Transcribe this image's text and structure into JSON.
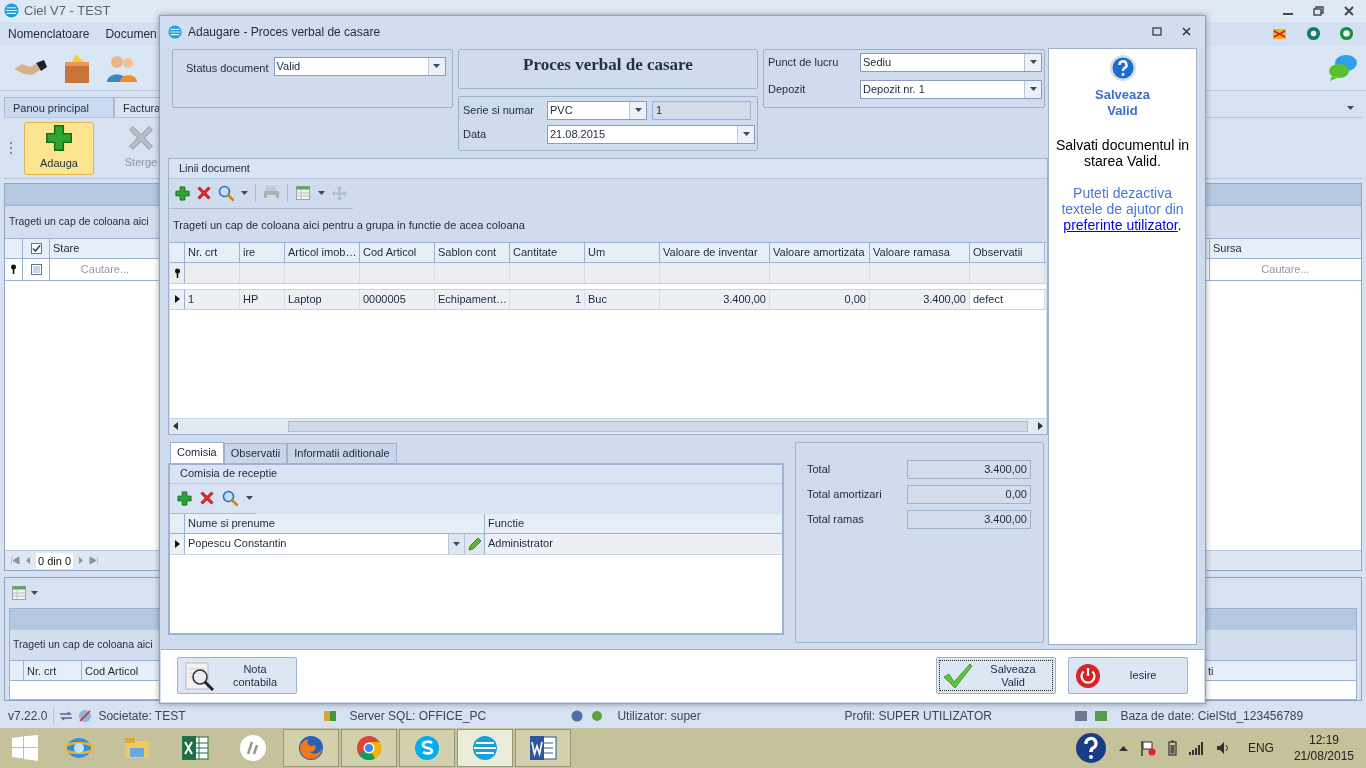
{
  "main_window": {
    "title": "Ciel V7 - TEST",
    "menu": [
      "Nomenclatoare",
      "Documen"
    ],
    "ribbon_tabs": [
      {
        "label": "Panou principal",
        "selected": true
      },
      {
        "label": "Factura",
        "selected": false
      }
    ],
    "ribbon_buttons": [
      {
        "label": "Adauga",
        "kind": "add",
        "highlighted": true,
        "disabled": false
      },
      {
        "label": "Sterge",
        "kind": "delete",
        "highlighted": false,
        "disabled": true
      }
    ],
    "grid": {
      "group_hint": "Trageti un cap de coloana aici",
      "columns": [
        "Stare",
        "Sursa"
      ],
      "header_checked": true,
      "filter_checked": false,
      "filter_placeholders": [
        "Cautare...",
        "Cautare..."
      ],
      "pager": "0 din 0"
    },
    "lower_grid": {
      "group_hint": "Trageti un cap de coloana aici",
      "columns": [
        "Nr. crt",
        "Cod Articol",
        "ti"
      ]
    }
  },
  "dialog": {
    "title": "Adaugare - Proces verbal de casare",
    "status": {
      "label": "Status document",
      "value": "Valid"
    },
    "heading": "Proces verbal de casare",
    "series": {
      "label": "Serie si numar",
      "value": "PVC",
      "number": "1"
    },
    "date": {
      "label": "Data",
      "value": "21.08.2015"
    },
    "work_point": {
      "label": "Punct de lucru",
      "value": "Sediu"
    },
    "warehouse": {
      "label": "Depozit",
      "value": "Depozit nr. 1"
    },
    "lines": {
      "title": "Linii document",
      "group_hint": "Trageti un cap de coloana aici pentru a grupa in functie de acea coloana",
      "columns": [
        {
          "label": "Nr. crt",
          "kind": "text"
        },
        {
          "label": "ire",
          "kind": "text"
        },
        {
          "label": "Articol imob…",
          "kind": "text"
        },
        {
          "label": "Cod Articol",
          "kind": "text"
        },
        {
          "label": "Sablon cont",
          "kind": "text"
        },
        {
          "label": "Cantitate",
          "kind": "number"
        },
        {
          "label": "Um",
          "kind": "text"
        },
        {
          "label": "Valoare de inventar",
          "kind": "number"
        },
        {
          "label": "Valoare amortizata",
          "kind": "number"
        },
        {
          "label": "Valoare ramasa",
          "kind": "number"
        },
        {
          "label": "Observatii",
          "kind": "text"
        }
      ],
      "rows": [
        {
          "selected": true,
          "cells": [
            "1",
            "HP",
            "Laptop",
            "0000005",
            "Echipament…",
            "1",
            "Buc",
            "3.400,00",
            "0,00",
            "3.400,00",
            "defect"
          ]
        }
      ]
    },
    "tabs": [
      {
        "label": "Comisia",
        "selected": true
      },
      {
        "label": "Observatii",
        "selected": false
      },
      {
        "label": "Informatii aditionale",
        "selected": false
      }
    ],
    "commission": {
      "title": "Comisia de receptie",
      "columns": [
        "Nume si prenume",
        "Functie"
      ],
      "rows": [
        {
          "name": "Popescu Constantin",
          "role": "Administrator",
          "selected": true
        }
      ]
    },
    "totals": [
      {
        "label": "Total",
        "value": "3.400,00"
      },
      {
        "label": "Total amortizari",
        "value": "0,00"
      },
      {
        "label": "Total ramas",
        "value": "3.400,00"
      }
    ],
    "help": {
      "title": "Salveaza Valid",
      "text": "Salvati documentul in starea Valid.",
      "hint": "Puteti dezactiva textele de ajutor din",
      "link": "preferinte utilizator",
      "hint_end": "."
    },
    "buttons": [
      {
        "label": "Nota contabila",
        "kind": "ledger",
        "focused": false
      },
      {
        "label": "Salveaza Valid",
        "kind": "save",
        "focused": true
      },
      {
        "label": "Iesire",
        "kind": "exit",
        "focused": false
      }
    ]
  },
  "status_bar": {
    "version": "v7.22.0",
    "items": [
      "Societate: TEST",
      "Server SQL: OFFICE_PC",
      "Utilizator: super",
      "Profil: SUPER UTILIZATOR",
      "Baza de date: CielStd_123456789"
    ]
  },
  "taskbar": {
    "apps": [
      {
        "kind": "ie",
        "running": false,
        "selected": false
      },
      {
        "kind": "folder",
        "running": false,
        "selected": false
      },
      {
        "kind": "excel",
        "running": false,
        "selected": false
      },
      {
        "kind": "hp",
        "running": false,
        "selected": false
      },
      {
        "kind": "firefox",
        "running": true,
        "selected": false
      },
      {
        "kind": "chrome",
        "running": true,
        "selected": false
      },
      {
        "kind": "skype",
        "running": true,
        "selected": false
      },
      {
        "kind": "ciel",
        "running": true,
        "selected": true
      },
      {
        "kind": "word",
        "running": true,
        "selected": false
      }
    ],
    "tray": {
      "language": "ENG",
      "time": "12:19",
      "date": "21/08/2015"
    }
  }
}
